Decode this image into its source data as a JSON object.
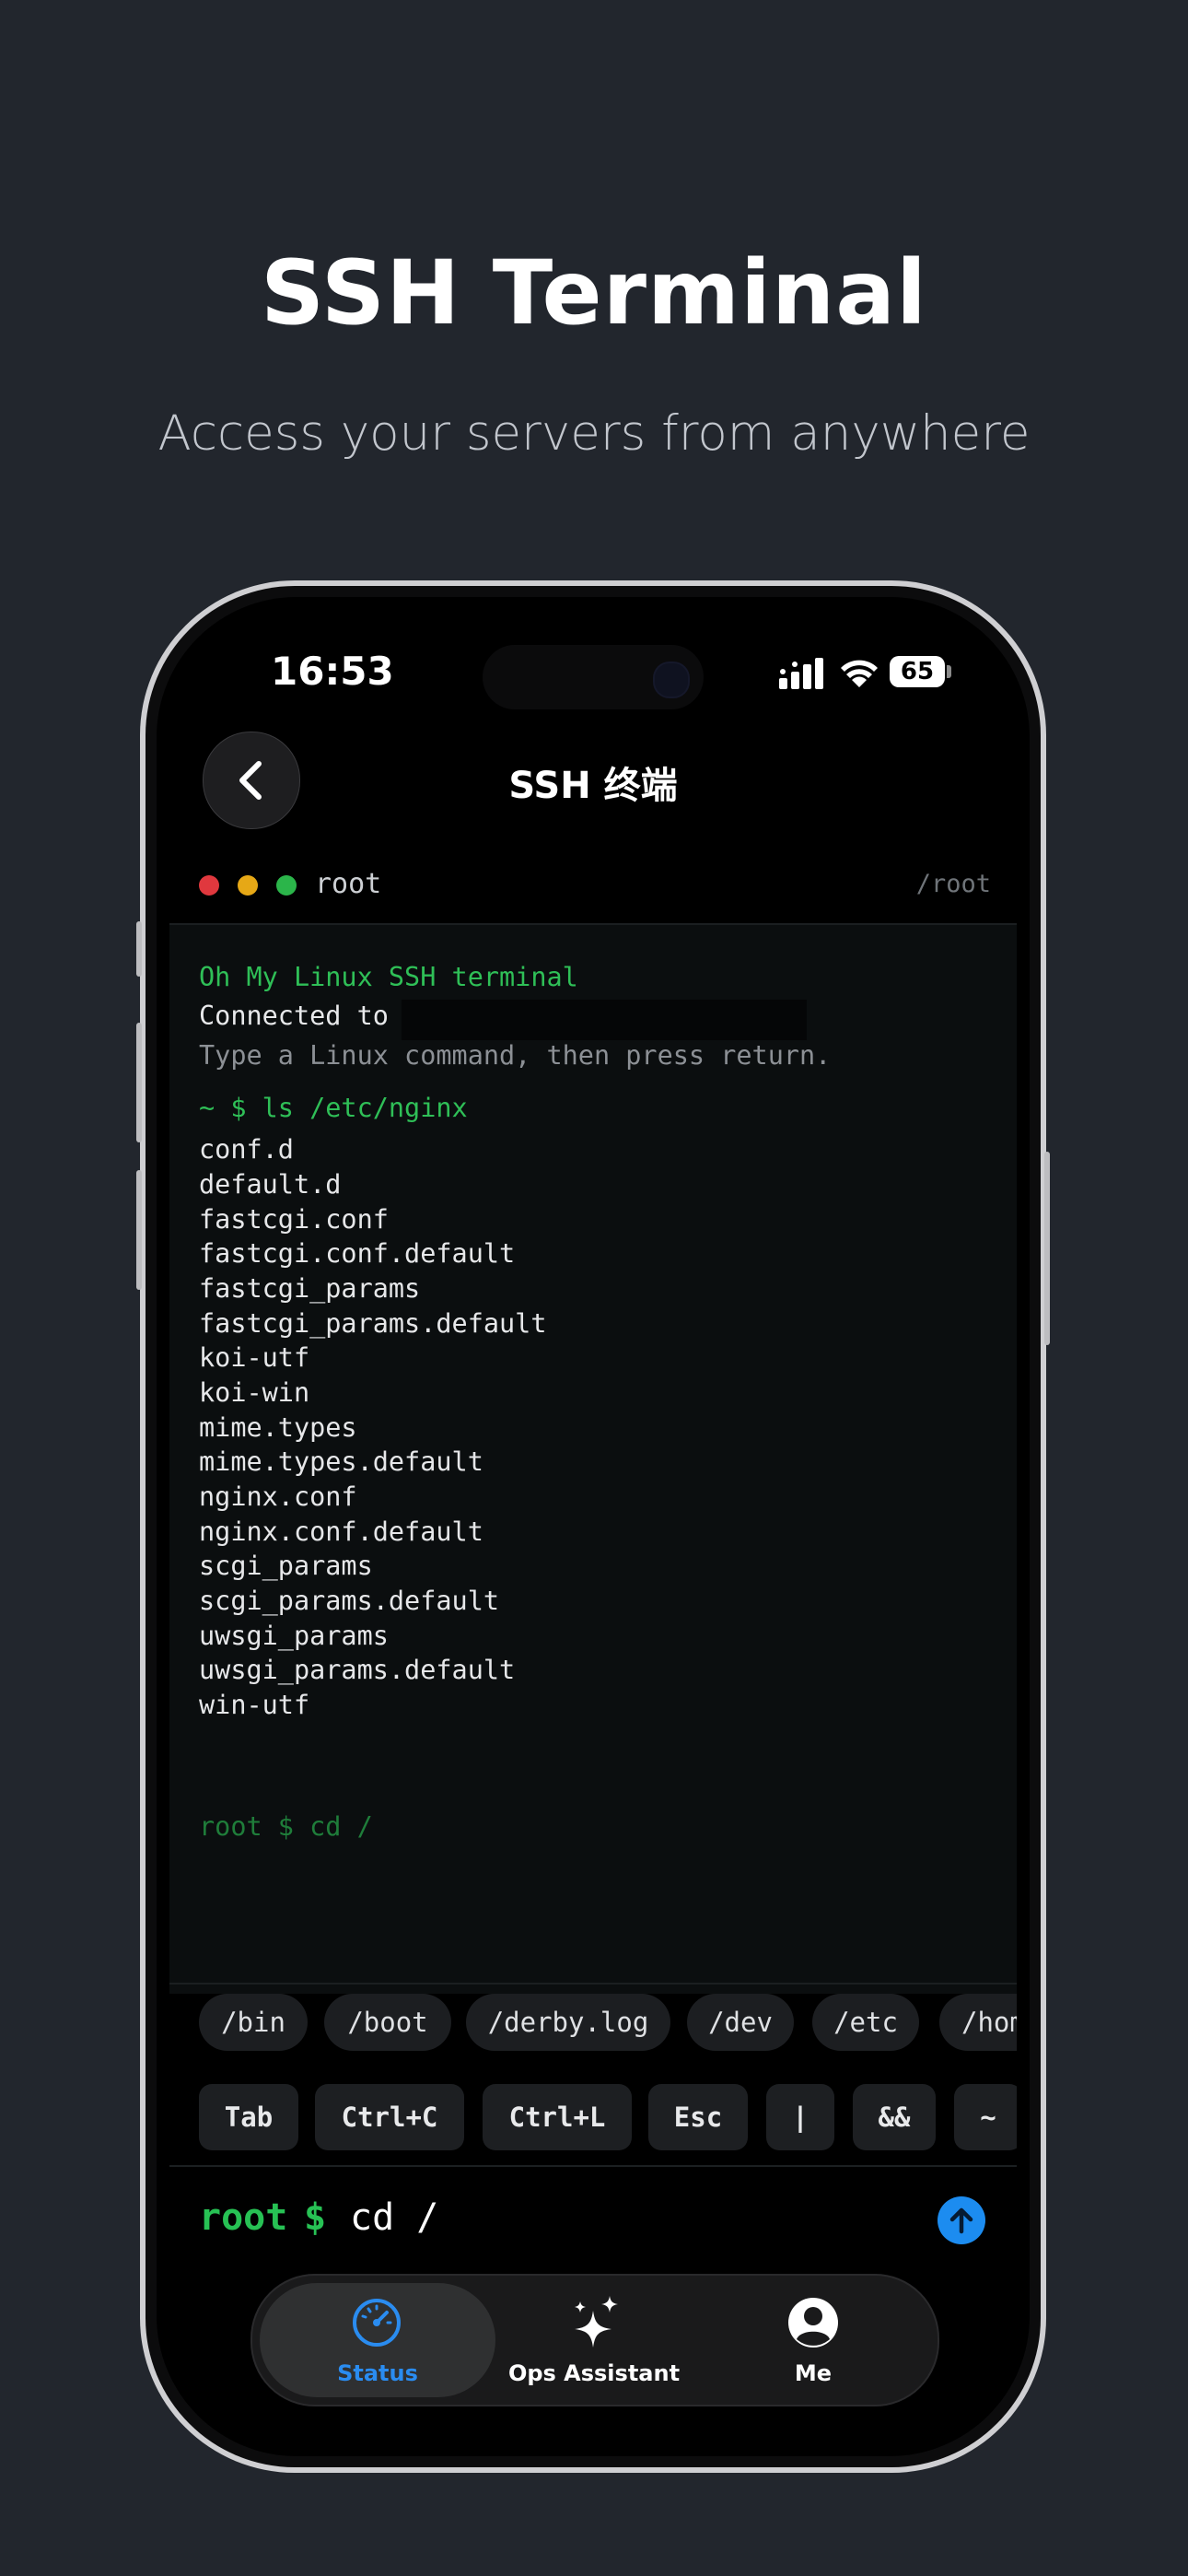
{
  "promo": {
    "headline": "SSH Terminal",
    "subheadline": "Access your servers from anywhere"
  },
  "status_bar": {
    "time": "16:53",
    "battery": "65"
  },
  "nav": {
    "title": "SSH 终端"
  },
  "terminal_header": {
    "user": "root",
    "path": "/root",
    "dot_colors": [
      "#e0383e",
      "#e6a816",
      "#2bb54a"
    ]
  },
  "terminal": {
    "banner": "Oh My Linux SSH terminal",
    "connected": "Connected to",
    "hint": "Type a Linux command, then press return.",
    "command_line": "~ $ ls /etc/nginx",
    "output": [
      "conf.d",
      "default.d",
      "fastcgi.conf",
      "fastcgi.conf.default",
      "fastcgi_params",
      "fastcgi_params.default",
      "koi-utf",
      "koi-win",
      "mime.types",
      "mime.types.default",
      "nginx.conf",
      "nginx.conf.default",
      "scgi_params",
      "scgi_params.default",
      "uwsgi_params",
      "uwsgi_params.default",
      "win-utf"
    ],
    "pending": "root $ cd /"
  },
  "path_chips": [
    "/bin",
    "/boot",
    "/derby.log",
    "/dev",
    "/etc",
    "/hom"
  ],
  "keys": [
    "Tab",
    "Ctrl+C",
    "Ctrl+L",
    "Esc",
    "|",
    "&&",
    "~"
  ],
  "input": {
    "user": "root",
    "dollar": "$",
    "command": "cd /"
  },
  "tabs": [
    {
      "label": "Status",
      "icon": "gauge-icon",
      "active": true
    },
    {
      "label": "Ops Assistant",
      "icon": "sparkles-icon",
      "active": false
    },
    {
      "label": "Me",
      "icon": "person-icon",
      "active": false
    }
  ],
  "colors": {
    "accent_green": "#27c154",
    "accent_blue": "#1c8cf0",
    "background": "#22262d"
  }
}
